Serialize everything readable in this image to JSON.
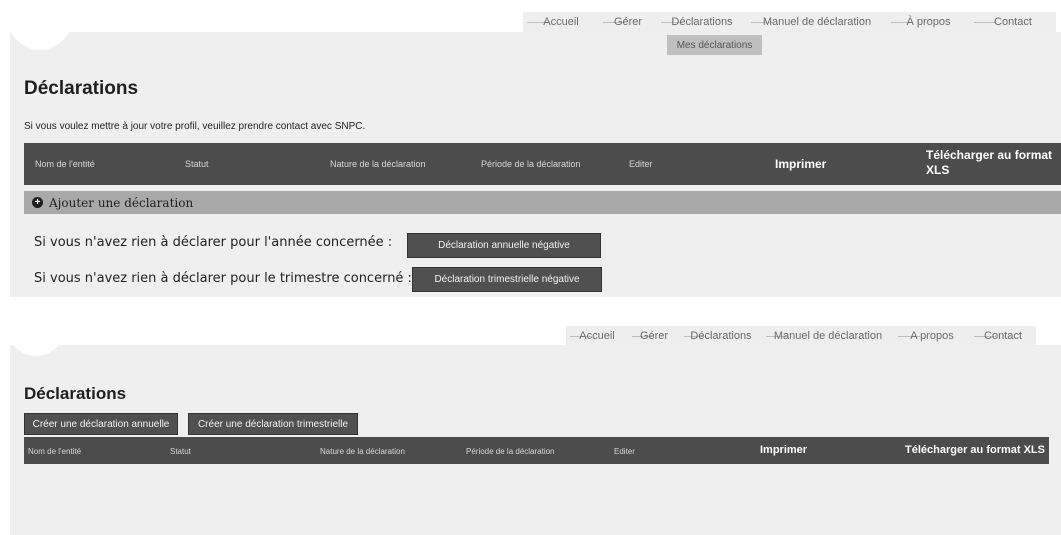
{
  "top": {
    "nav": [
      "Accueil",
      "Gérer",
      "Déclarations",
      "Manuel de déclaration",
      "À propos",
      "Contact"
    ],
    "subnav": "Mes déclarations",
    "title": "Déclarations",
    "info": "Si vous voulez mettre à jour votre profil, veuillez prendre contact avec SNPC.",
    "columns": [
      "Nom de l'entité",
      "Statut",
      "Nature de la déclaration",
      "Période de la déclaration",
      "Editer",
      "Imprimer",
      "Télécharger au format XLS"
    ],
    "add_label": "Ajouter une déclaration",
    "annual_text": "Si vous n'avez rien à déclarer pour l'année concernée :",
    "annual_button": "Déclaration annuelle négative",
    "quarter_text": "Si vous n'avez rien à déclarer pour le trimestre concerné :",
    "quarter_button": "Déclaration trimestrielle négative"
  },
  "bottom": {
    "nav": [
      "Accueil",
      "Gérer",
      "Déclarations",
      "Manuel de déclaration",
      "A propos",
      "Contact"
    ],
    "title": "Déclarations",
    "create_annual": "Créer une déclaration annuelle",
    "create_quarter": "Créer une déclaration trimestrielle",
    "columns": [
      "Nom de l'entité",
      "Statut",
      "Nature de la déclaration",
      "Période de la déclaration",
      "Editer",
      "Imprimer",
      "Télécharger au format XLS"
    ]
  }
}
